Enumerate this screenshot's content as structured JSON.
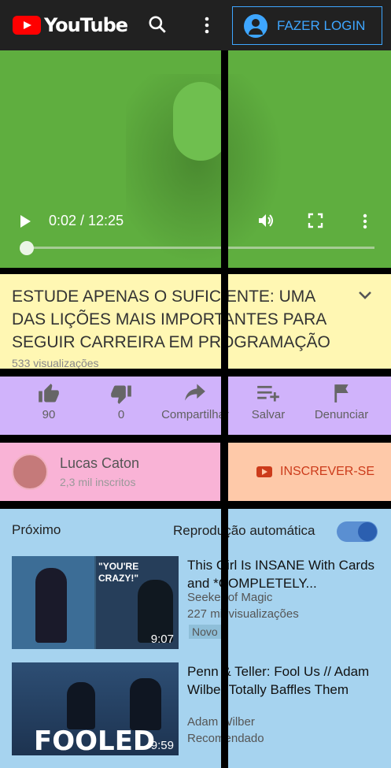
{
  "header": {
    "logo_text": "YouTube",
    "login_label": "FAZER LOGIN",
    "icons": [
      "search-icon",
      "more-vert-icon",
      "account-icon"
    ]
  },
  "player": {
    "time": "0:02 / 12:25",
    "progress_fraction": 0.0027
  },
  "video": {
    "title": "ESTUDE APENAS O SUFICIENTE: UMA DAS LIÇÕES MAIS IMPORTANTES PARA SEGUIR CARREIRA EM PROGRAMAÇÃO",
    "views": "533 visualizações"
  },
  "actions": [
    {
      "label": "90",
      "icon": "thumbs-up-icon"
    },
    {
      "label": "0",
      "icon": "thumbs-down-icon"
    },
    {
      "label": "Compartilhar",
      "icon": "share-icon"
    },
    {
      "label": "Salvar",
      "icon": "playlist-add-icon"
    },
    {
      "label": "Denunciar",
      "icon": "flag-icon"
    }
  ],
  "channel": {
    "name": "Lucas Caton",
    "subscribers": "2,3 mil inscritos",
    "subscribe_label": "INSCREVER-SE"
  },
  "up_next": {
    "label": "Próximo",
    "autoplay_label": "Reprodução automática",
    "autoplay_on": true,
    "items": [
      {
        "title": "This Girl Is INSANE With Cards and *COMPLETELY...",
        "channel": "Seeker of Magic",
        "views": "227 mil visualizações",
        "badge": "Novo",
        "duration": "9:07",
        "thumb_text": "\"YOU'RE CRAZY!\""
      },
      {
        "title": "Penn & Teller: Fool Us // Adam Wilber Totally Baffles Them",
        "channel": "Adam Wilber",
        "views": "Recomendado",
        "duration": "9:59",
        "thumb_text": "FOOLED"
      }
    ]
  }
}
